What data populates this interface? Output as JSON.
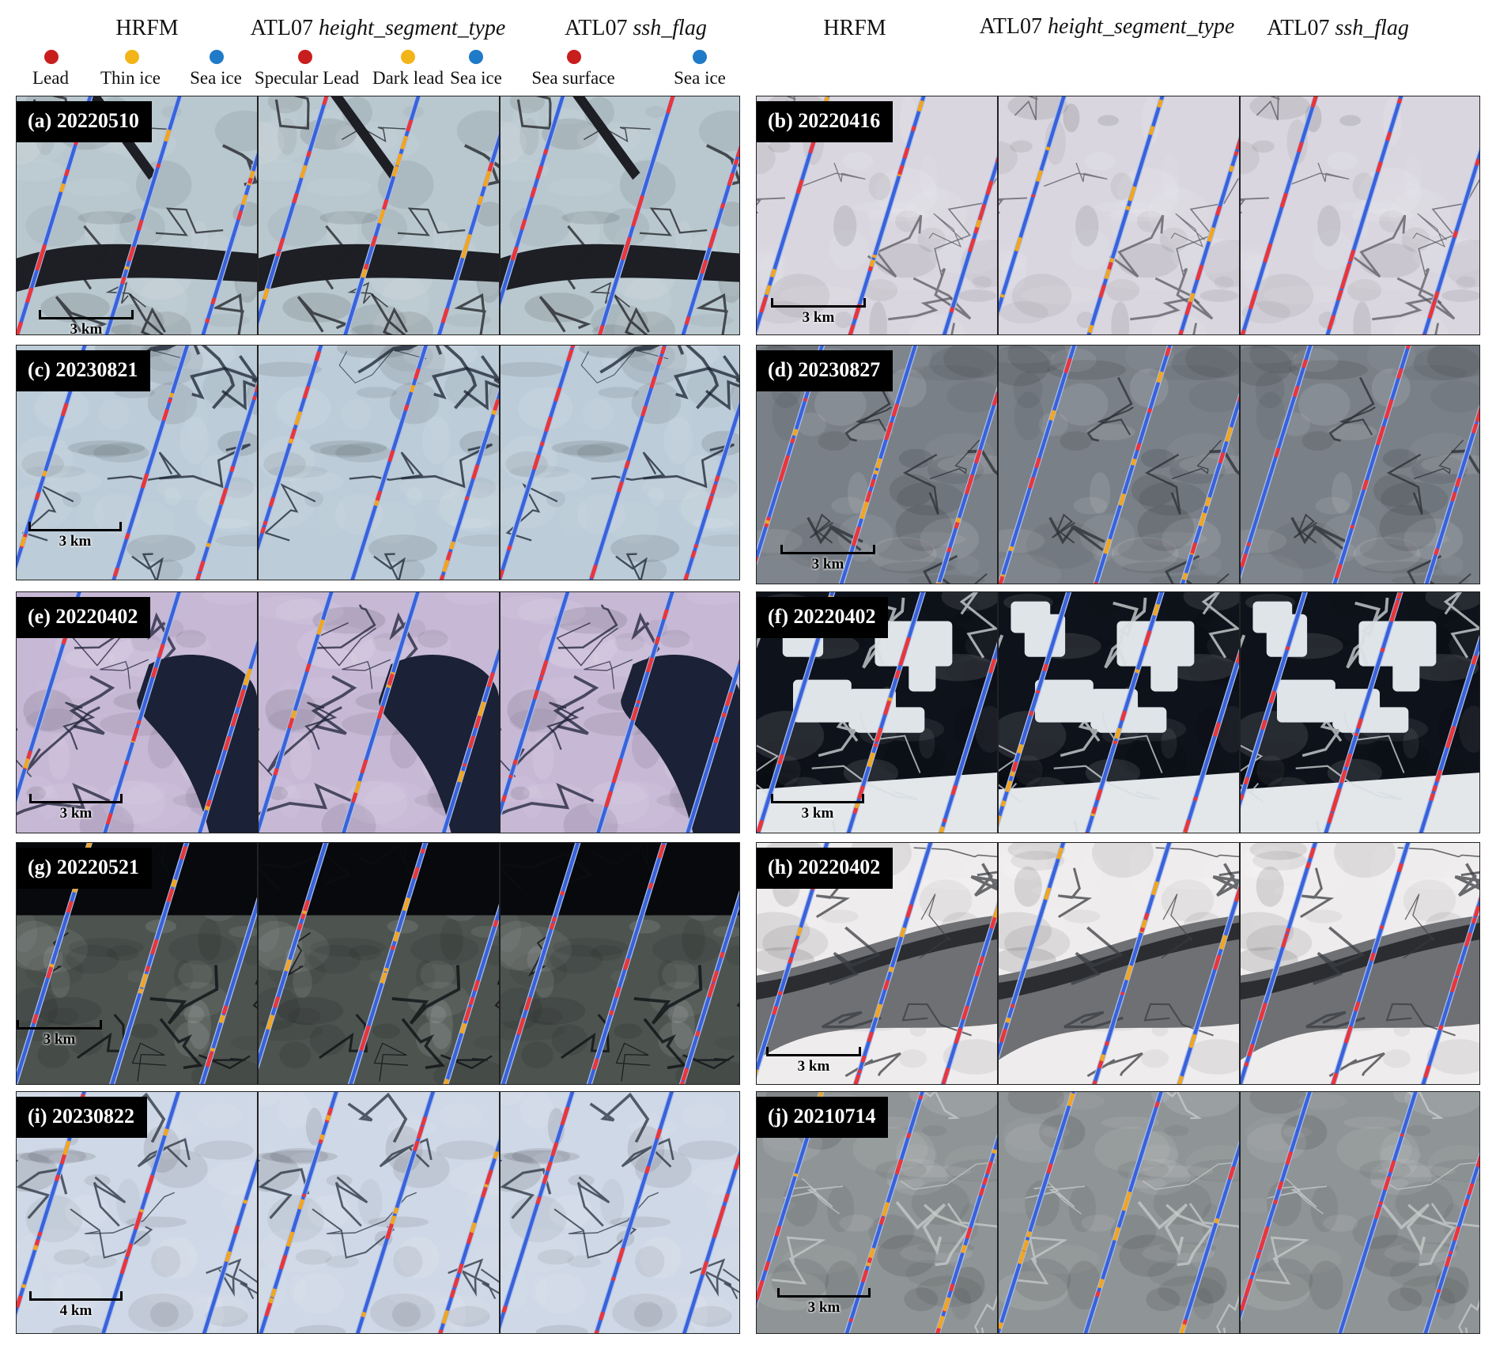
{
  "column_headers": {
    "hrfm": "HRFM",
    "atl07_prefix": "ATL07",
    "hst": "height_segment_type",
    "ssh": "ssh_flag"
  },
  "legend": {
    "hrfm": [
      {
        "label": "Lead",
        "color": "#c81e1e"
      },
      {
        "label": "Thin ice",
        "color": "#f2b418"
      },
      {
        "label": "Sea ice",
        "color": "#1f7ac8"
      }
    ],
    "hst": [
      {
        "label": "Specular Lead",
        "color": "#c81e1e"
      },
      {
        "label": "Dark lead",
        "color": "#f2b418"
      },
      {
        "label": "Sea ice",
        "color": "#1f7ac8"
      }
    ],
    "ssh": [
      {
        "label": "Sea surface",
        "color": "#c81e1e"
      },
      {
        "label": "Sea ice",
        "color": "#1f7ac8"
      }
    ]
  },
  "colors": {
    "track": "#3a62d8",
    "track_edge": "#a9c0f0",
    "lead": "#e8363a",
    "thin": "#f2a51f"
  },
  "panels": [
    {
      "id": "a",
      "label": "(a) 20220510",
      "scale": "3 km",
      "scene": "fractured-ice",
      "bg": "#b9c8cf",
      "crack": "#1d1f24"
    },
    {
      "id": "b",
      "label": "(b) 20220416",
      "scale": "3 km",
      "scene": "smooth-ice",
      "bg": "#d9d6df",
      "crack": "#5a5a60"
    },
    {
      "id": "c",
      "label": "(c) 20230821",
      "scale": "3 km",
      "scene": "floes-blue",
      "bg": "#bcccd8",
      "crack": "#1a2230"
    },
    {
      "id": "d",
      "label": "(d) 20230827",
      "scale": "3 km",
      "scene": "brash-ice",
      "bg": "#7a8088",
      "crack": "#2a2e34"
    },
    {
      "id": "e",
      "label": "(e) 20220402",
      "scale": "3 km",
      "scene": "cloudy-open-water",
      "bg": "#c7b8d6",
      "crack": "#1d2238"
    },
    {
      "id": "f",
      "label": "(f) 20220402",
      "scale": "3 km",
      "scene": "open-water-floes",
      "bg": "#0e121a",
      "crack": "#d7dce0"
    },
    {
      "id": "g",
      "label": "(g) 20220521",
      "scale": "3 km",
      "scene": "dark-mixed-ice",
      "bg": "#4d5450",
      "crack": "#0c0e12"
    },
    {
      "id": "h",
      "label": "(h) 20220402",
      "scale": "3 km",
      "scene": "white-ice-lead",
      "bg": "#efeced",
      "crack": "#3b3d42"
    },
    {
      "id": "i",
      "label": "(i) 20230822",
      "scale": "4 km",
      "scene": "blue-white-ice",
      "bg": "#cfd8e6",
      "crack": "#26303c"
    },
    {
      "id": "j",
      "label": "(j) 20210714",
      "scale": "3 km",
      "scene": "ridged-ice",
      "bg": "#8f9496",
      "crack": "#c8cccb"
    }
  ]
}
